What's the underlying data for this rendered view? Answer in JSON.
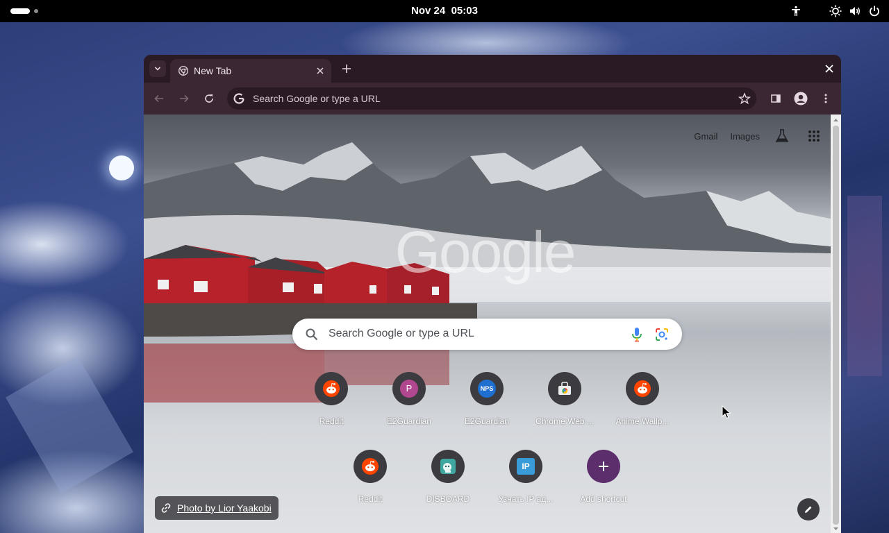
{
  "topbar": {
    "clock": "Nov 24  05:03",
    "icons": [
      "accessibility-icon",
      "brightness-icon",
      "volume-icon",
      "power-icon"
    ]
  },
  "browser": {
    "tab": {
      "title": "New Tab"
    },
    "omnibox": {
      "placeholder": "Search Google or type a URL"
    }
  },
  "ntp": {
    "links": {
      "gmail": "Gmail",
      "images": "Images"
    },
    "logo": "Google",
    "search_placeholder": "Search Google or type a URL",
    "shortcuts": [
      {
        "label": "Reddit",
        "icon": "reddit-icon"
      },
      {
        "label": "E2Guardian",
        "icon": "letter-p-icon",
        "letter": "P"
      },
      {
        "label": "E2Guardian",
        "icon": "nps-icon",
        "letter": "NPS"
      },
      {
        "label": "Chrome Web ...",
        "icon": "chrome-web-store-icon"
      },
      {
        "label": "Anime Wallp...",
        "icon": "reddit-icon"
      },
      {
        "label": "Reddit",
        "icon": "reddit-icon"
      },
      {
        "label": "DISBOARD",
        "icon": "disboard-icon"
      },
      {
        "label": "Узнать IP ад...",
        "icon": "ip-icon",
        "letter": "IP"
      },
      {
        "label": "Add shortcut",
        "icon": "plus-icon"
      }
    ],
    "attribution": "Photo by Lior Yaakobi"
  },
  "colors": {
    "topbar": "#000000",
    "tabstrip": "#2a1a24",
    "toolbar": "#3b2633",
    "reddit": "#ff4500",
    "add_shortcut": "#5c2e6b"
  }
}
